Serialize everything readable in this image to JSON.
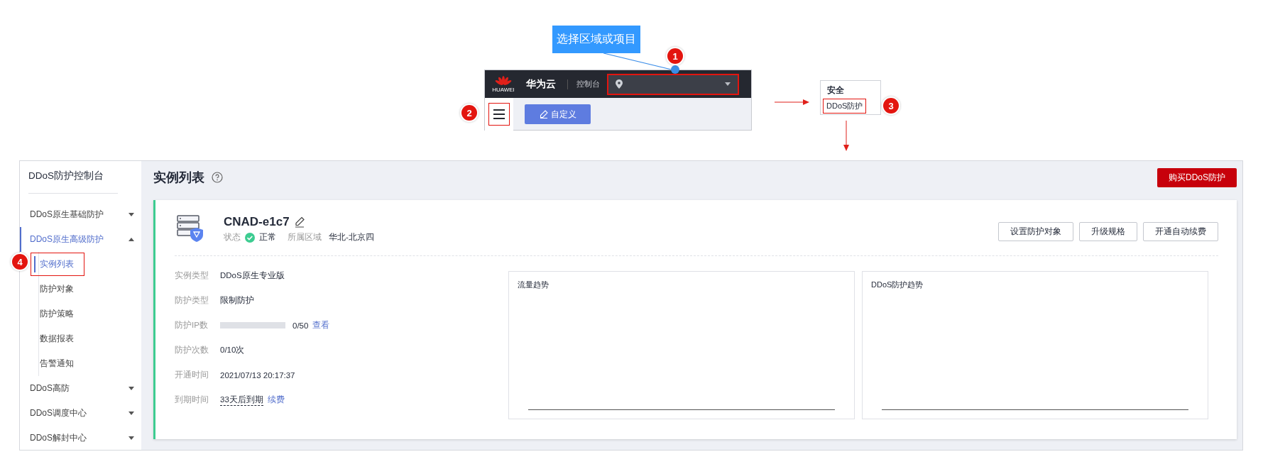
{
  "callout": {
    "text": "选择区域或项目"
  },
  "step_markers": [
    "1",
    "2",
    "3",
    "4"
  ],
  "console_header": {
    "logo_caption": "HUAWEI",
    "brand": "华为云",
    "console": "控制台",
    "region_selector_highlighted": true,
    "menu_highlighted": true,
    "customize_button": "自定义"
  },
  "service_popup": {
    "category": "安全",
    "item": "DDoS防护",
    "item_highlighted": true
  },
  "sidebar": {
    "title": "DDoS防护控制台",
    "items": [
      {
        "label": "DDoS原生基础防护",
        "expanded": false,
        "selected": false
      },
      {
        "label": "DDoS原生高级防护",
        "expanded": true,
        "selected": true,
        "children": [
          {
            "label": "实例列表",
            "selected": true,
            "highlighted": true
          },
          {
            "label": "防护对象",
            "selected": false,
            "highlighted": false
          },
          {
            "label": "防护策略",
            "selected": false,
            "highlighted": false
          },
          {
            "label": "数据报表",
            "selected": false,
            "highlighted": false
          },
          {
            "label": "告警通知",
            "selected": false,
            "highlighted": false
          }
        ]
      },
      {
        "label": "DDoS高防",
        "expanded": false,
        "selected": false
      },
      {
        "label": "DDoS调度中心",
        "expanded": false,
        "selected": false
      },
      {
        "label": "DDoS解封中心",
        "expanded": false,
        "selected": false
      }
    ]
  },
  "page": {
    "title": "实例列表",
    "buy_button": "购买DDoS防护"
  },
  "instance": {
    "name": "CNAD-e1c7",
    "status_label": "状态",
    "status": "正常",
    "region_label": "所属区域",
    "region": "华北-北京四",
    "actions": [
      "设置防护对象",
      "升级规格",
      "开通自动续费"
    ],
    "details": [
      {
        "kind": "text",
        "label": "实例类型",
        "value": "DDoS原生专业版"
      },
      {
        "kind": "text",
        "label": "防护类型",
        "value": "限制防护"
      },
      {
        "kind": "progress",
        "label": "防护IP数",
        "level": 0,
        "reading": "0/50",
        "link": "查看"
      },
      {
        "kind": "text",
        "label": "防护次数",
        "value": "0/10次"
      },
      {
        "kind": "text",
        "label": "开通时间",
        "value": "2021/07/13 20:17:37"
      },
      {
        "kind": "expiry",
        "label": "到期时间",
        "value": "33天后到期",
        "link": "续费"
      }
    ],
    "charts": [
      {
        "title": "流量趋势"
      },
      {
        "title": "DDoS防护趋势"
      }
    ]
  }
}
